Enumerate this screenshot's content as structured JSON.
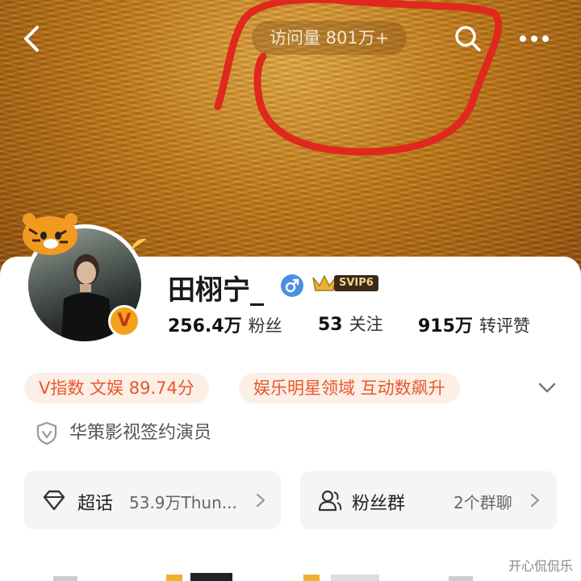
{
  "header": {
    "visit_label": "访问量 801万+"
  },
  "profile": {
    "name": "田栩宁_",
    "svip_label": "SVIP6",
    "verified_badge": "V",
    "stats": [
      {
        "value": "256.4万",
        "label": "粉丝"
      },
      {
        "value": "53",
        "label": "关注"
      },
      {
        "value": "915万",
        "label": "转评赞"
      }
    ],
    "tags": [
      "V指数 文娱 89.74分",
      "娱乐明星领域 互动数飙升"
    ],
    "verification": "华策影视签约演员"
  },
  "actions": [
    {
      "title": "超话",
      "subtitle": "53.9万Thun...",
      "icon": "diamond-icon"
    },
    {
      "title": "粉丝群",
      "subtitle": "2个群聊",
      "icon": "group-icon"
    }
  ],
  "watermark": "开心侃侃乐",
  "colors": {
    "accent_orange": "#e8572d",
    "tag_bg": "#fcefe6",
    "gender_blue": "#4a8fe0",
    "annotation_red": "#e0281e"
  }
}
